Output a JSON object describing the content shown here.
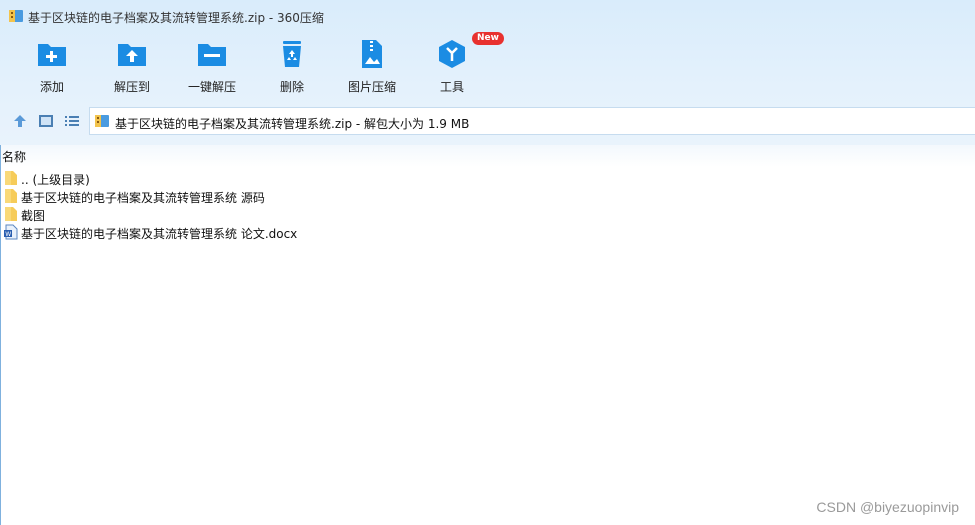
{
  "window": {
    "title": "基于区块链的电子档案及其流转管理系统.zip - 360压缩",
    "icon": "zip-archive-icon"
  },
  "toolbar": {
    "add": {
      "label": "添加",
      "icon": "add-folder-icon"
    },
    "extract_to": {
      "label": "解压到",
      "icon": "extract-folder-icon"
    },
    "one_click_extract": {
      "label": "一键解压",
      "icon": "one-click-extract-icon"
    },
    "delete": {
      "label": "删除",
      "icon": "recycle-bin-icon"
    },
    "image_compress": {
      "label": "图片压缩",
      "icon": "image-compress-icon"
    },
    "tools": {
      "label": "工具",
      "icon": "tools-cube-icon",
      "badge": "New"
    }
  },
  "navigation": {
    "up": "up-arrow-icon",
    "view": "thumbnail-view-icon",
    "list": "list-view-icon"
  },
  "address": {
    "text": "基于区块链的电子档案及其流转管理系统.zip - 解包大小为 1.9 MB"
  },
  "file_list": {
    "column_name": "名称",
    "items": [
      {
        "name": ".. (上级目录)",
        "icon": "folder-icon"
      },
      {
        "name": "基于区块链的电子档案及其流转管理系统 源码",
        "icon": "folder-icon"
      },
      {
        "name": "截图",
        "icon": "folder-icon"
      },
      {
        "name": "基于区块链的电子档案及其流转管理系统 论文.docx",
        "icon": "word-document-icon"
      }
    ]
  },
  "watermark": "CSDN @biyezuopinvip",
  "colors": {
    "accent_blue": "#1b8ce3",
    "chrome_bg": "#dcedfb",
    "badge_red": "#e8312f",
    "folder_yellow": "#f6cc5a"
  }
}
